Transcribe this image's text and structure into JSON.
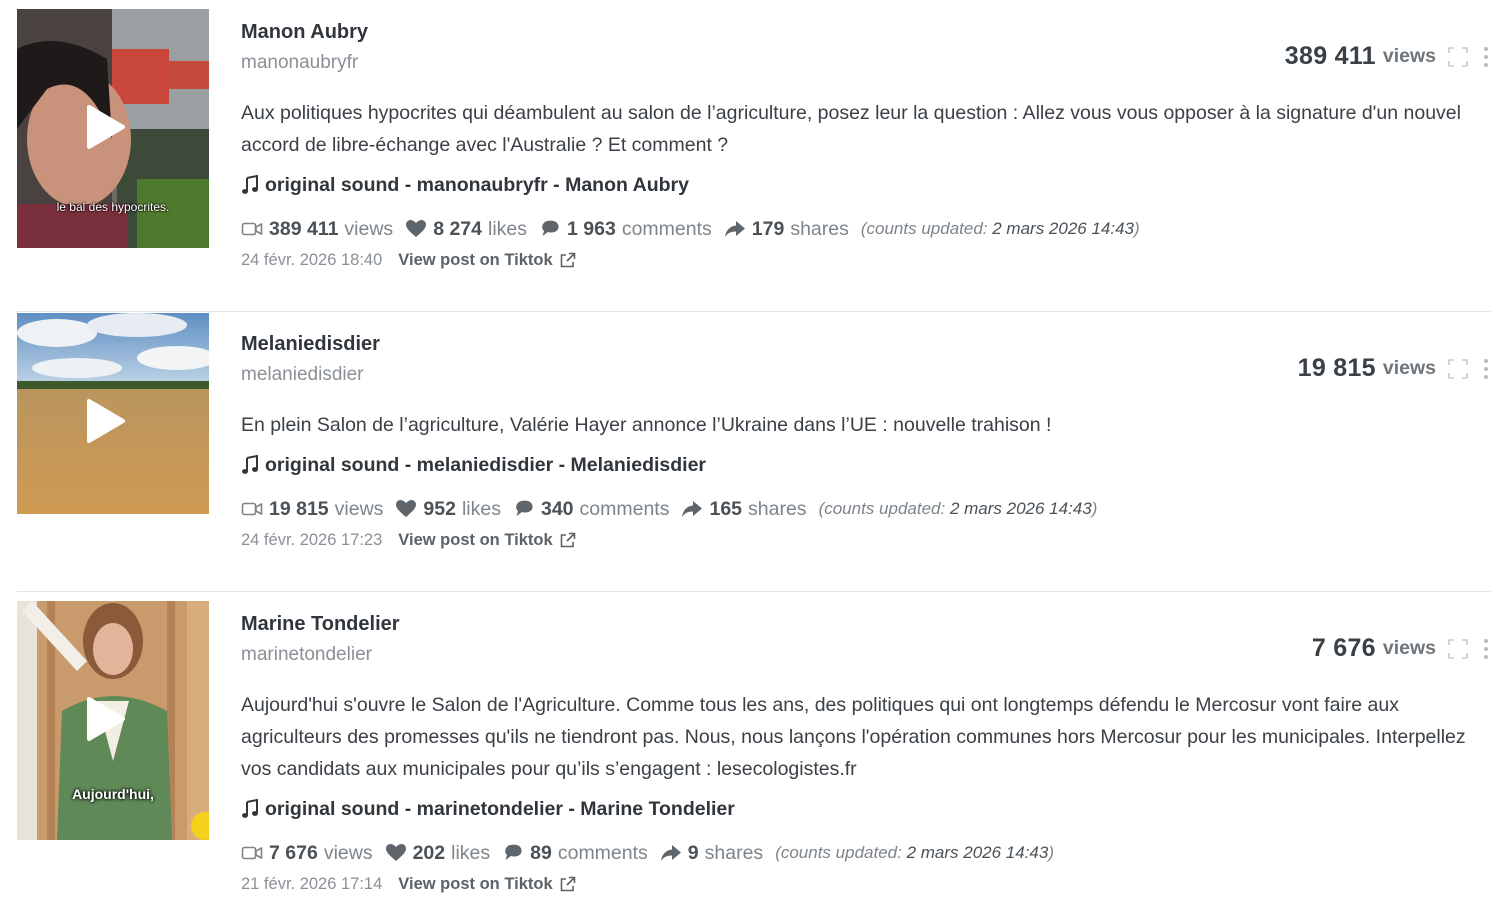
{
  "posts": [
    {
      "author": "Manon Aubry",
      "handle": "manonaubryfr",
      "text": "Aux politiques hypocrites qui déambulent au salon de l’agriculture, posez leur la question : Allez vous vous opposer à la signature d'un nouvel accord de libre-échange avec l'Australie ? Et comment ?",
      "sound": "original sound - manonaubryfr - Manon Aubry",
      "views": "389 411",
      "likes": "8 274",
      "comments": "1 963",
      "shares": "179",
      "updated_label": "(counts updated: ",
      "updated_date": "2 mars 2026 14:43",
      "updated_close": ")",
      "date": "24 févr. 2026 18:40",
      "thumbnail_caption": "le bal des hypocrites."
    },
    {
      "author": "Melaniedisdier",
      "handle": "melaniedisdier",
      "text": "En plein Salon de l’agriculture, Valérie Hayer annonce l’Ukraine dans l’UE : nouvelle trahison !",
      "sound": "original sound - melaniedisdier - Melaniedisdier",
      "views": "19 815",
      "likes": "952",
      "comments": "340",
      "shares": "165",
      "updated_label": "(counts updated: ",
      "updated_date": "2 mars 2026 14:43",
      "updated_close": ")",
      "date": "24 févr. 2026 17:23",
      "thumbnail_caption": ""
    },
    {
      "author": "Marine Tondelier",
      "handle": "marinetondelier",
      "text": "Aujourd'hui s'ouvre le Salon de l'Agriculture. Comme tous les ans, des politiques qui ont longtemps défendu le Mercosur vont faire aux agriculteurs des promesses qu'ils ne tiendront pas. Nous, nous lançons l'opération communes hors Mercosur pour les municipales. Interpellez vos candidats aux municipales pour qu’ils s’engagent : lesecologistes.fr",
      "sound": "original sound - marinetondelier - Marine Tondelier",
      "views": "7 676",
      "likes": "202",
      "comments": "89",
      "shares": "9",
      "updated_label": "(counts updated: ",
      "updated_date": "2 mars 2026 14:43",
      "updated_close": ")",
      "date": "21 févr. 2026 17:14",
      "thumbnail_caption": "Aujourd'hui,"
    }
  ],
  "labels": {
    "views": "views",
    "likes": "likes",
    "comments": "comments",
    "shares": "shares",
    "view_post": "View post on Tiktok"
  },
  "icons": {
    "video": "video-camera-icon",
    "like": "heart-icon",
    "comment": "comment-bubble-icon",
    "share": "share-arrow-icon",
    "sound": "music-note-icon",
    "external": "external-link-icon",
    "expand": "expand-icon",
    "menu": "kebab-menu-icon",
    "play": "play-icon"
  },
  "colors": {
    "text_dark": "#30363c",
    "text_muted": "#8a9096",
    "divider": "#e3e5e8"
  }
}
